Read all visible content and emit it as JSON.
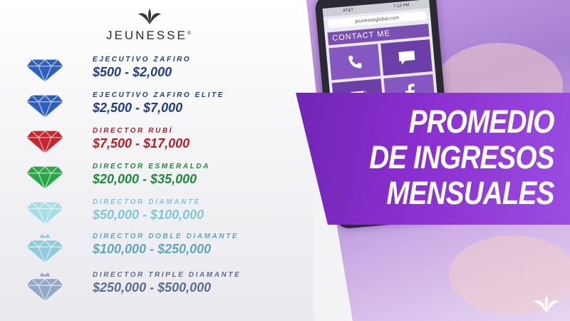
{
  "brand": {
    "name": "JEUNESSE",
    "registered": "®",
    "colors": {
      "primary": "#7125b4"
    }
  },
  "headline": {
    "lines": [
      "PROMEDIO",
      "DE INGRESOS",
      "MENSUALES"
    ]
  },
  "phone": {
    "time": "7:13 PM",
    "carrier": "AT&T",
    "url": "jeunesseglobal.com",
    "contact_label": "CONTACT ME",
    "tile_icons": [
      "phone-icon",
      "chat-bubble-icon",
      "envelope-icon",
      "facebook-icon"
    ]
  },
  "ranks": [
    {
      "name": "EJECUTIVO ZAFIRO",
      "range": "$500 - $2,000",
      "color": "#1f3d86",
      "gem_color": "#2d5fbd",
      "crown": false
    },
    {
      "name": "EJECUTIVO ZAFIRO ELITE",
      "range": "$2,500 - $7,000",
      "color": "#1f3d86",
      "gem_color": "#2d5fbd",
      "crown": false
    },
    {
      "name": "DIRECTOR RUBÍ",
      "range": "$7,500 - $17,000",
      "color": "#b81e24",
      "gem_color": "#c8262c",
      "crown": false
    },
    {
      "name": "DIRECTOR ESMERALDA",
      "range": "$20,000 - $35,000",
      "color": "#1d8a3a",
      "gem_color": "#2aa548",
      "crown": false
    },
    {
      "name": "DIRECTOR DIAMANTE",
      "range": "$50,000 - $100,000",
      "color": "#7fc7d5",
      "gem_color": "#a8dde6",
      "crown": false
    },
    {
      "name": "DIRECTOR DOBLE DIAMANTE",
      "range": "$100,000 - $250,000",
      "color": "#5fa6b8",
      "gem_color": "#8fcbd8",
      "crown": true
    },
    {
      "name": "DIRECTOR TRIPLE DIAMANTE",
      "range": "$250,000 - $500,000",
      "color": "#5a6f8e",
      "gem_color": "#93a7c6",
      "crown": true
    }
  ]
}
